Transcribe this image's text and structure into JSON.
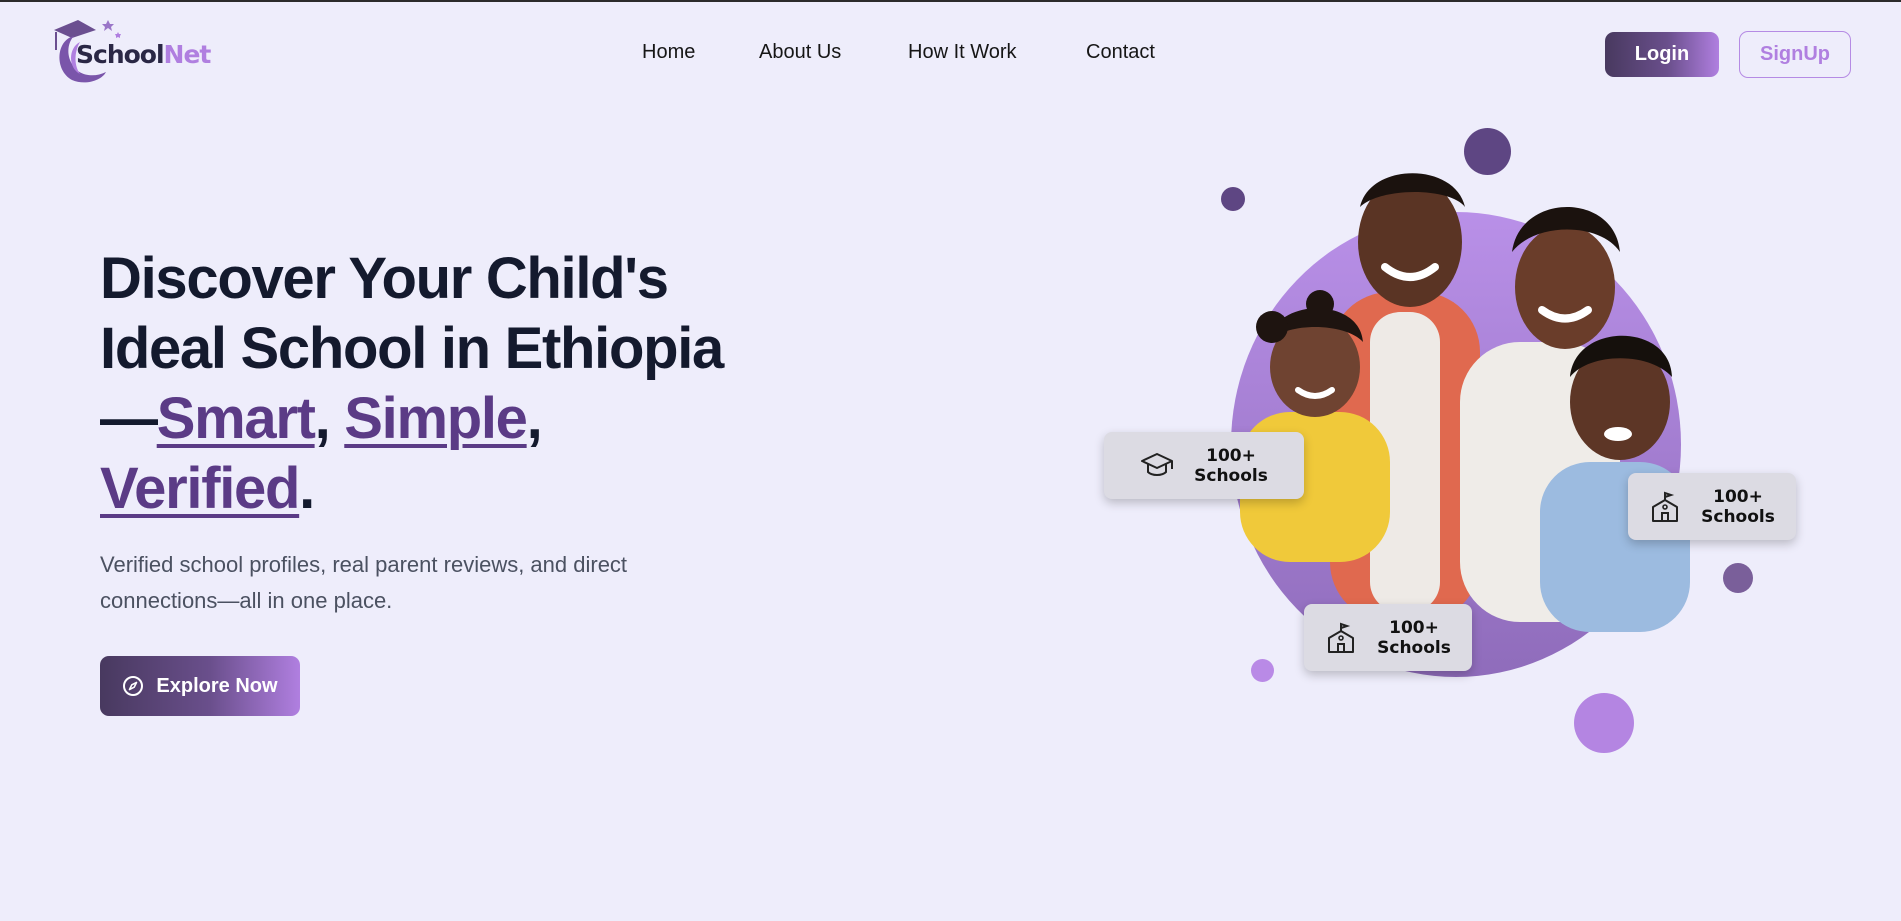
{
  "header": {
    "logo": {
      "text_a": "School",
      "text_b": "Net"
    },
    "nav": [
      {
        "label": "Home"
      },
      {
        "label": "About Us"
      },
      {
        "label": "How It Work"
      },
      {
        "label": "Contact"
      }
    ],
    "login_label": "Login",
    "signup_label": "SignUp"
  },
  "hero": {
    "title_line1": "Discover Your Child's",
    "title_line2": "Ideal School in Ethiopia",
    "title_dash": "—",
    "highlight_1": "Smart",
    "comma_1": ",",
    "highlight_2": "Simple",
    "comma_2": ",",
    "highlight_3": "Verified",
    "period": ".",
    "subtitle": "Verified school profiles, real parent reviews, and direct connections—all in one place.",
    "cta_label": "Explore Now",
    "cta_icon": "compass-icon"
  },
  "badges": [
    {
      "icon": "graduation-cap-icon",
      "line1": "100+",
      "line2": "Schools"
    },
    {
      "icon": "school-building-icon",
      "line1": "100+",
      "line2": "Schools"
    },
    {
      "icon": "school-building-icon",
      "line1": "100+",
      "line2": "Schools"
    }
  ],
  "colors": {
    "background": "#eeedfb",
    "accent_dark": "#48395f",
    "accent_light": "#b07fe0",
    "highlight_text": "#5b3b86"
  }
}
